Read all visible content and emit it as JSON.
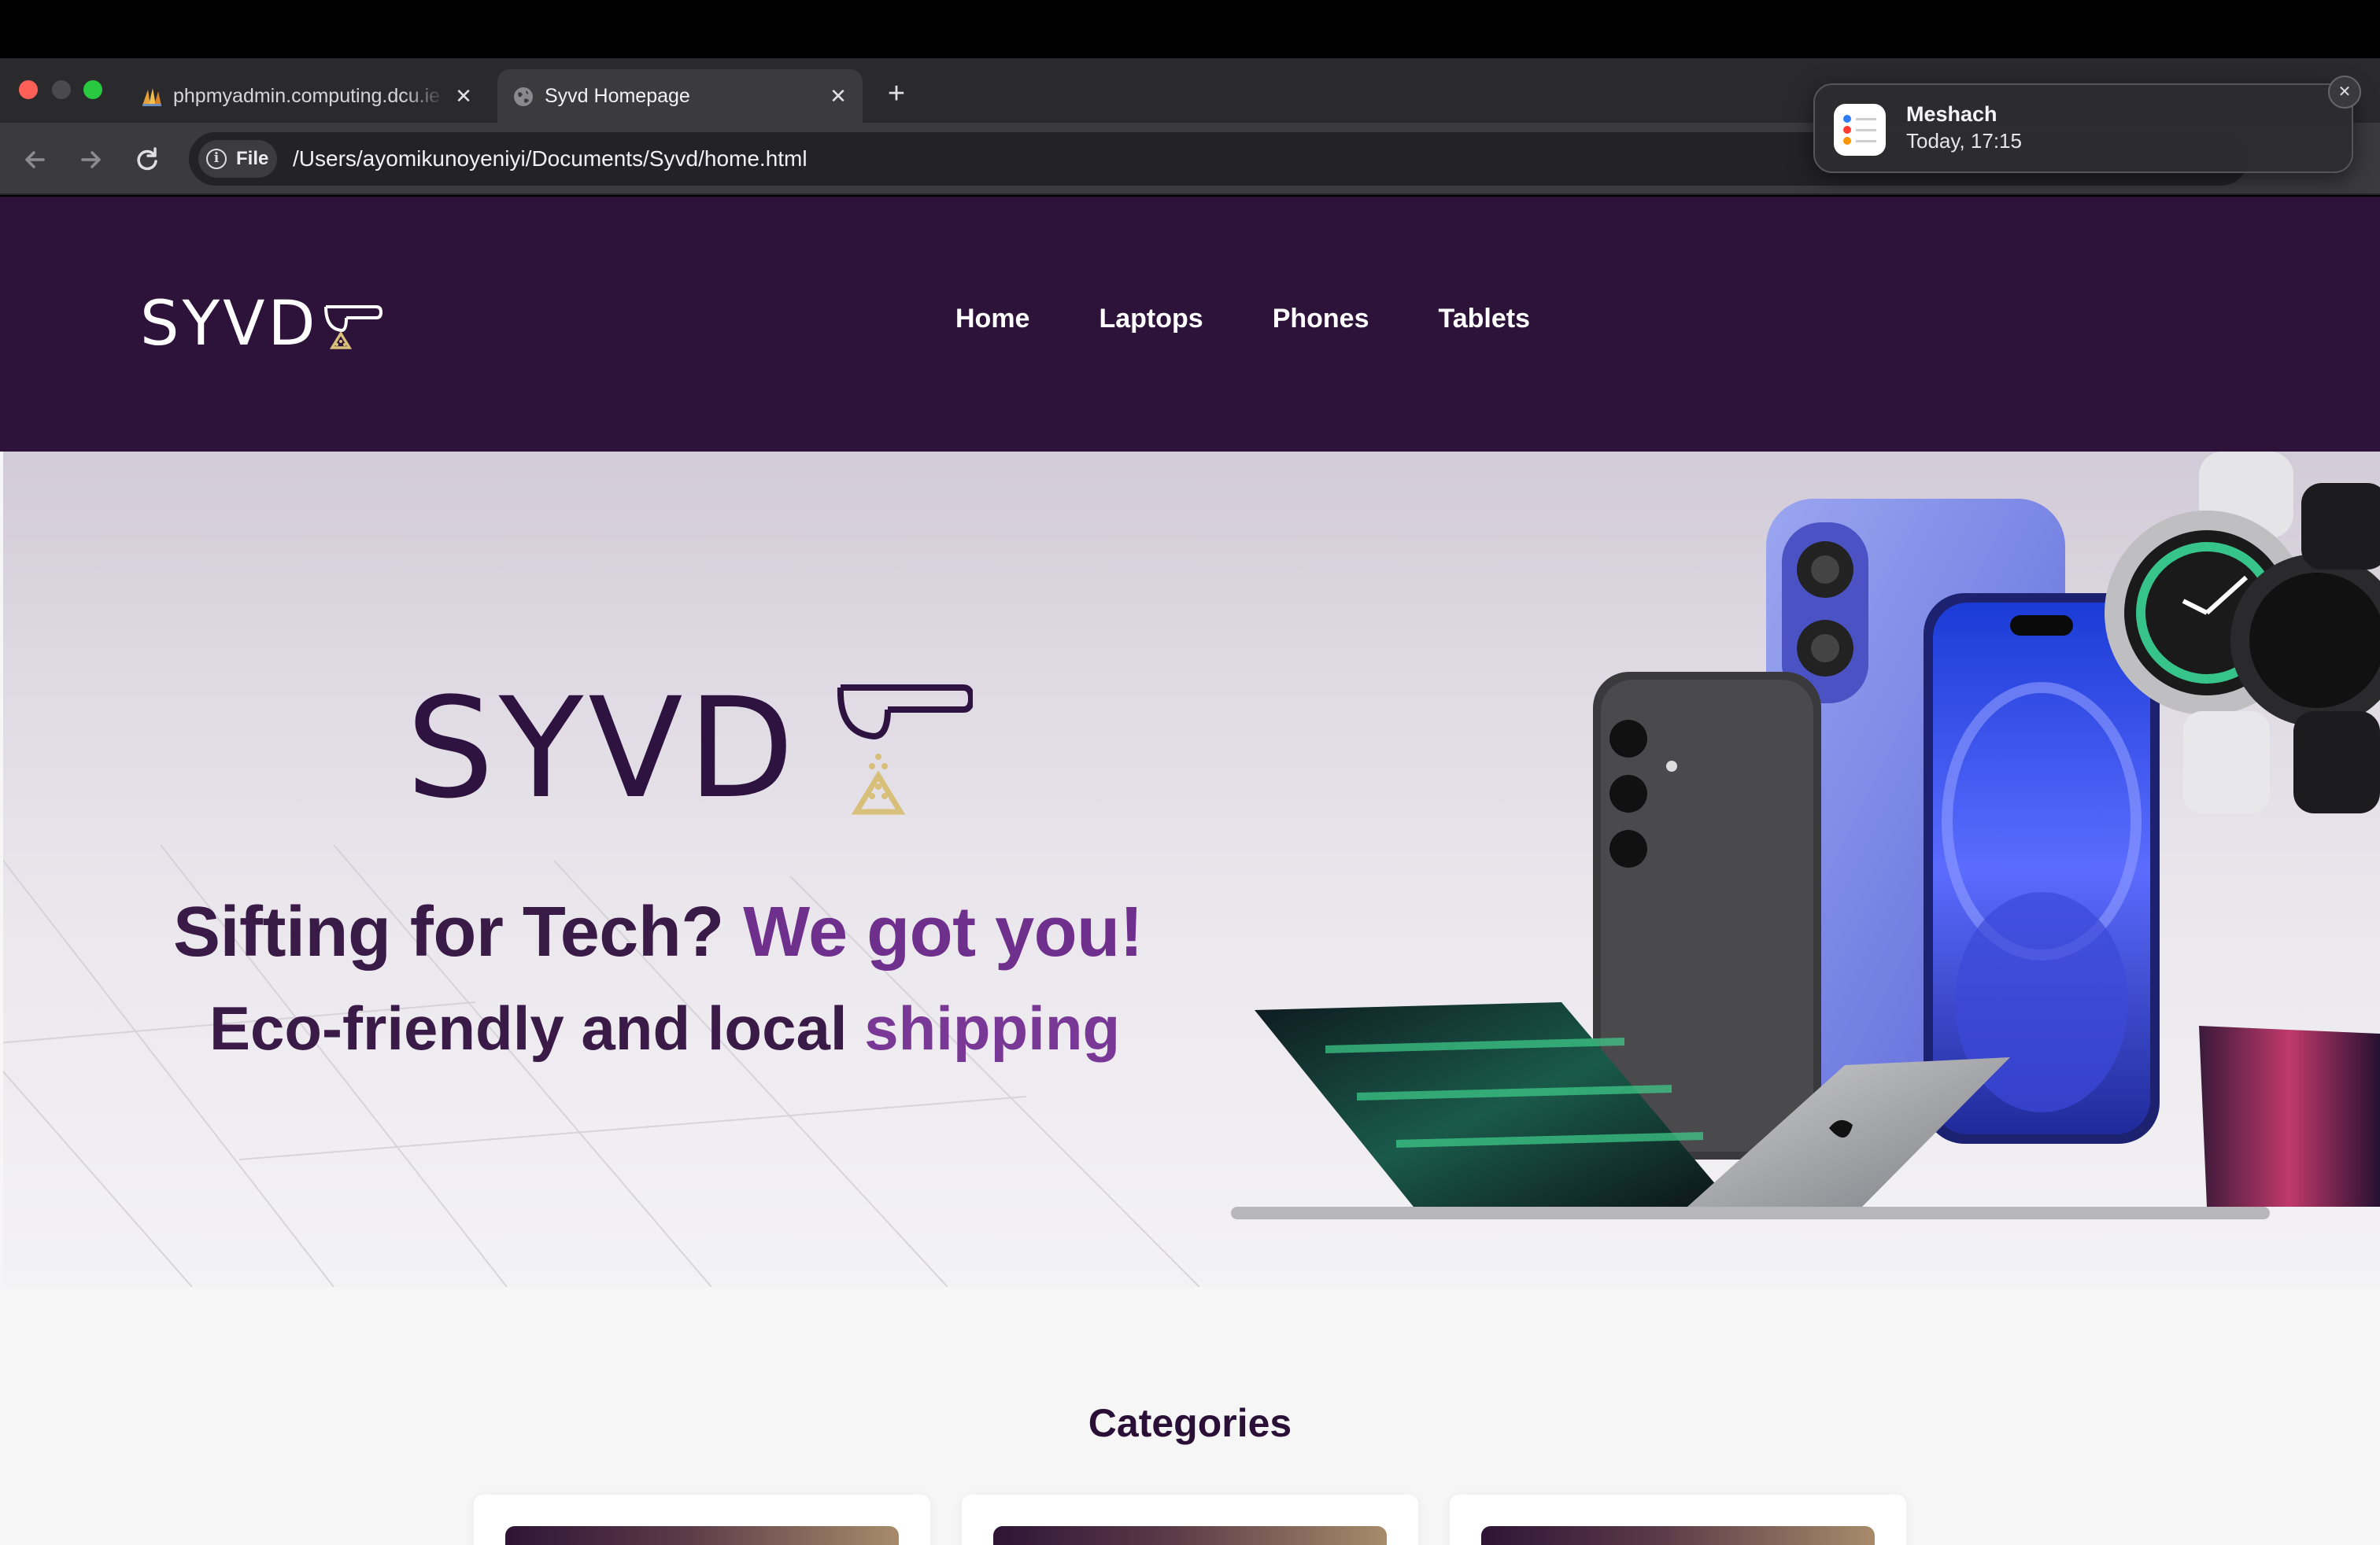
{
  "browser": {
    "tabs": [
      {
        "title": "phpmyadmin.computing.dcu.ie",
        "active": false,
        "favicon": "phpmyadmin-icon"
      },
      {
        "title": "Syvd Homepage",
        "active": true,
        "favicon": "globe-icon"
      }
    ],
    "address": {
      "scheme_chip": "File",
      "url": "/Users/ayomikunoyeniyi/Documents/Syvd/home.html"
    }
  },
  "notification": {
    "title": "Meshach",
    "time": "Today, 17:15",
    "app_icon": "reminders-icon"
  },
  "site": {
    "brand": "SYVD",
    "nav": [
      "Home",
      "Laptops",
      "Phones",
      "Tablets"
    ],
    "hero": {
      "brand": "SYVD",
      "headline_part1": "Sifting for Tech?",
      "headline_part2": "We got you!",
      "subline_part1": "Eco-friendly and local",
      "subline_part2": "shipping"
    },
    "categories_title": "Categories"
  },
  "colors": {
    "header_bg": "#2d1339",
    "accent_purple": "#6f2f8c",
    "dark_purple": "#3a1a47",
    "gold": "#d8bf7a"
  }
}
